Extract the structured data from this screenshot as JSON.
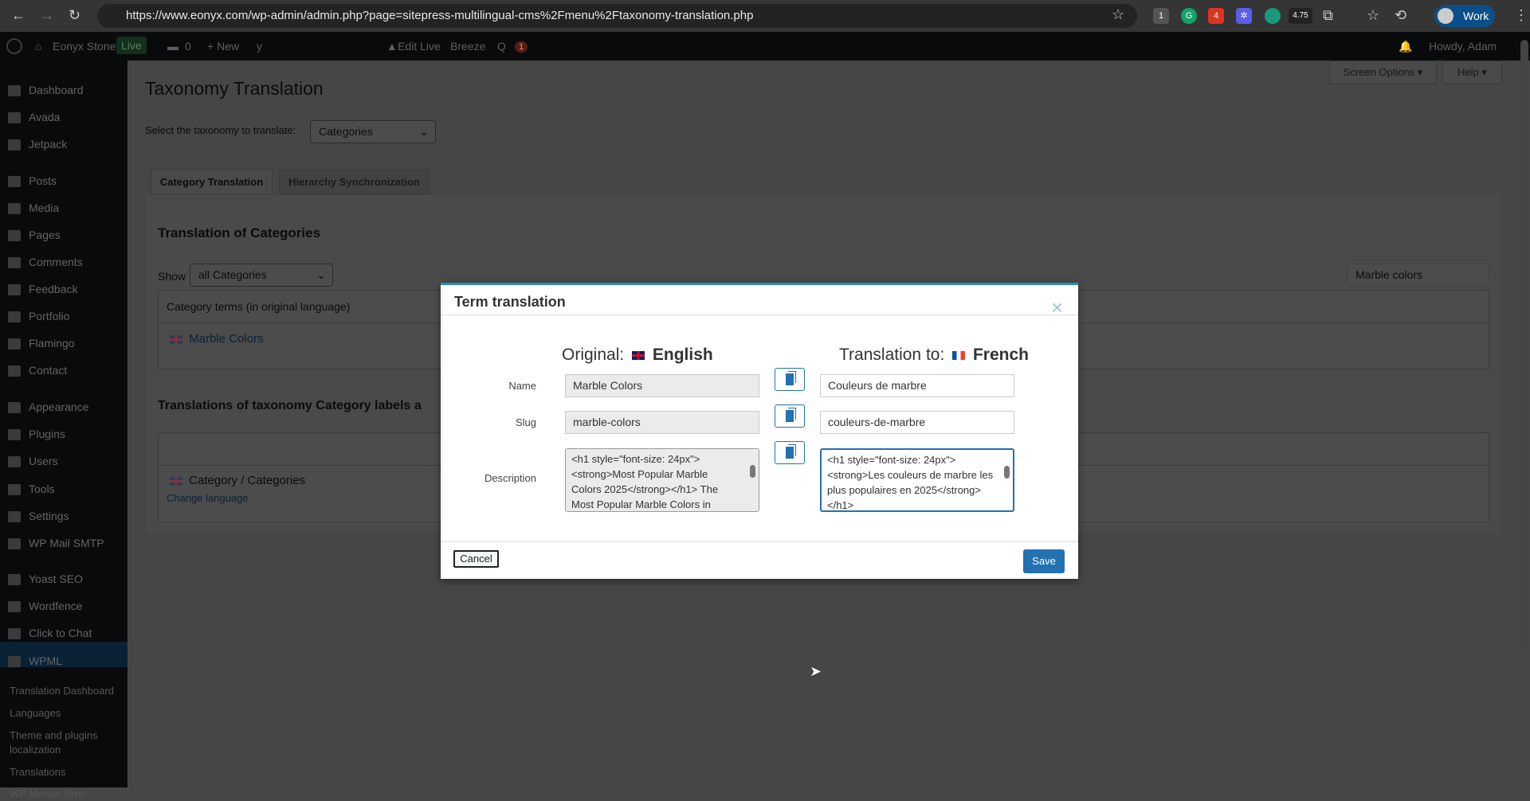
{
  "browser": {
    "url": "https://www.eonyx.com/wp-admin/admin.php?page=sitepress-multilingual-cms%2Fmenu%2Ftaxonomy-translation.php",
    "profile": "Work",
    "ext_badges": [
      "1",
      "4",
      "4.75"
    ]
  },
  "adminbar": {
    "site": "Eonyx Stone",
    "live": "Live",
    "comments": "0",
    "new": "New",
    "edit_live": "Edit Live",
    "breeze": "Breeze",
    "wpml_badge": "1",
    "howdy": "Howdy, Adam"
  },
  "sidebar": {
    "items": [
      "Dashboard",
      "Avada",
      "Jetpack",
      "Posts",
      "Media",
      "Pages",
      "Comments",
      "Feedback",
      "Portfolio",
      "Flamingo",
      "Contact",
      "Appearance",
      "Plugins",
      "Users",
      "Tools",
      "Settings",
      "WP Mail SMTP",
      "Yoast SEO",
      "Wordfence",
      "Click to Chat",
      "WPML"
    ],
    "submenu": [
      "Translation Dashboard",
      "Languages",
      "Theme and plugins localization",
      "Translations",
      "WP Menus Sync"
    ]
  },
  "page": {
    "title": "Taxonomy Translation",
    "screen_options": "Screen Options ▾",
    "help": "Help ▾",
    "select_label": "Select the taxonomy to translate:",
    "taxonomy": "Categories",
    "tabs": [
      "Category Translation",
      "Hierarchy Synchronization"
    ],
    "section_title": "Translation of Categories",
    "show_label": "Show",
    "show_value": "all Categories",
    "search_value": "Marble colors",
    "col_header": "Category terms (in original language)",
    "term": "Marble Colors",
    "labels_title": "Translations of taxonomy Category labels a",
    "labels_row": "Category / Categories",
    "change_language": "Change language"
  },
  "modal": {
    "title": "Term translation",
    "original_label": "Original:",
    "original_lang": "English",
    "translation_label": "Translation to:",
    "translation_lang": "French",
    "name_label": "Name",
    "slug_label": "Slug",
    "desc_label": "Description",
    "orig_name": "Marble Colors",
    "orig_slug": "marble-colors",
    "orig_desc": "<h1 style=\"font-size: 24px\"> <strong>Most Popular Marble Colors 2025</strong></h1> The Most Popular Marble Colors in",
    "tr_name": "Couleurs de marbre",
    "tr_slug": "couleurs-de-marbre",
    "tr_desc": "<h1 style=\"font-size: 24px\"> <strong>Les couleurs de marbre les plus populaires en 2025</strong></h1>",
    "cancel": "Cancel",
    "save": "Save",
    "close": "×"
  }
}
